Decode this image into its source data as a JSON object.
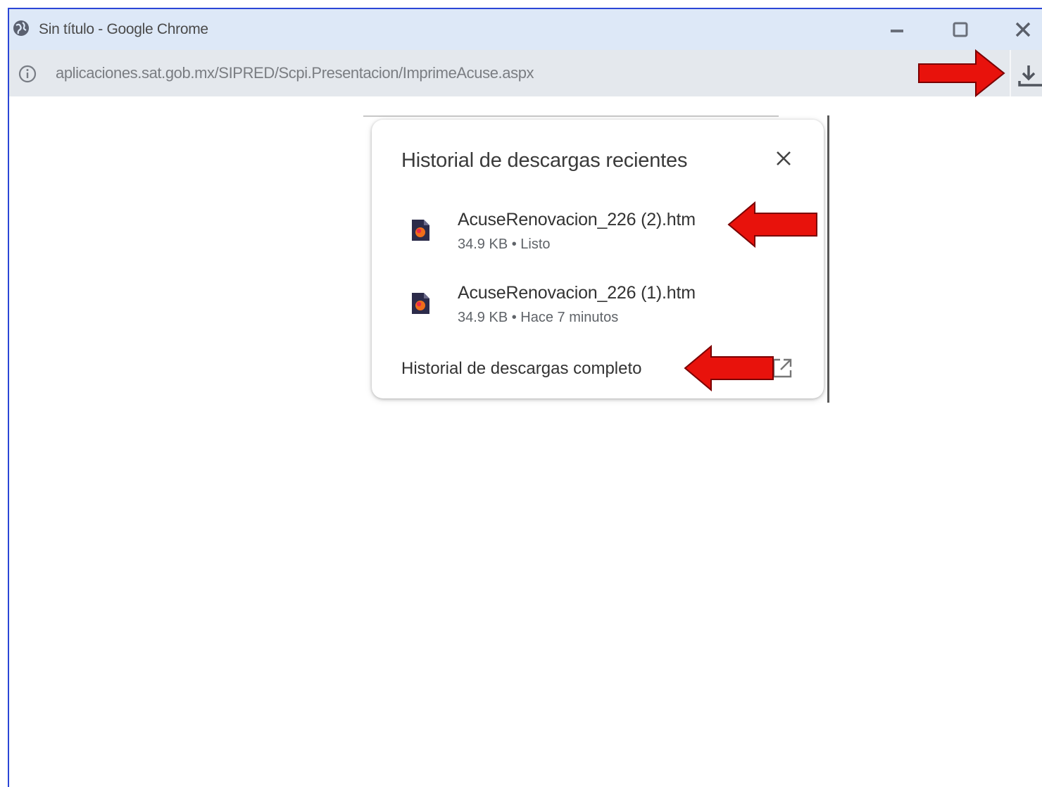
{
  "window": {
    "title": "Sin título - Google Chrome",
    "controls": {
      "minimize_icon": "minimize-icon",
      "maximize_icon": "maximize-icon",
      "close_icon": "close-icon"
    }
  },
  "addressbar": {
    "info_icon": "info-icon",
    "url": "aplicaciones.sat.gob.mx/SIPRED/Scpi.Presentacion/ImprimeAcuse.aspx",
    "download_icon": "download-icon"
  },
  "downloads_popup": {
    "title": "Historial de descargas recientes",
    "close_icon": "close-icon",
    "items": [
      {
        "name": "AcuseRenovacion_226 (2).htm",
        "meta": "34.9 KB • Listo",
        "icon": "html-file-icon"
      },
      {
        "name": "AcuseRenovacion_226 (1).htm",
        "meta": "34.9 KB • Hace 7 minutos",
        "icon": "html-file-icon"
      }
    ],
    "full_history_label": "Historial de descargas completo",
    "open_new_tab_icon": "open-in-new-icon"
  },
  "annotations": {
    "arrow_color": "#e8120c",
    "arrow_outline": "#7a0000"
  },
  "colors": {
    "window_border": "#2b46d6",
    "titlebar_bg": "#dde8f7",
    "addressbar_bg": "#e4e8ed"
  }
}
